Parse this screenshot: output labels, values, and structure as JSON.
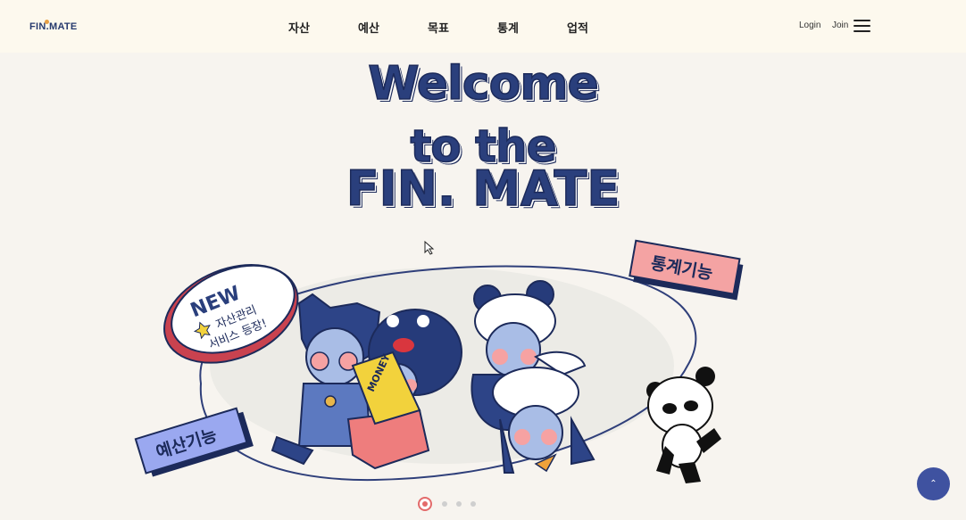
{
  "header": {
    "logo": "FIN.MATE",
    "nav": [
      "자산",
      "예산",
      "목표",
      "통계",
      "업적"
    ],
    "login": "Login",
    "join": "Join"
  },
  "hero": {
    "line1": "Welcome",
    "line2": "to the",
    "line3": "FIN. MATE"
  },
  "badges": {
    "new": "NEW",
    "new_line1": "자산관리",
    "new_line2": "서비스 등장!",
    "stats": "통계기능",
    "budget": "예산기능",
    "sign": "MONEY"
  },
  "carousel": {
    "total": 4,
    "active": 1
  },
  "colors": {
    "navy": "#2a3f7c",
    "accent_red": "#e36b6b",
    "pink": "#f4a3a3",
    "lavender": "#9aa8f0",
    "top_button": "#3f52a0"
  },
  "scroll_top_icon": "chevron-up-icon"
}
